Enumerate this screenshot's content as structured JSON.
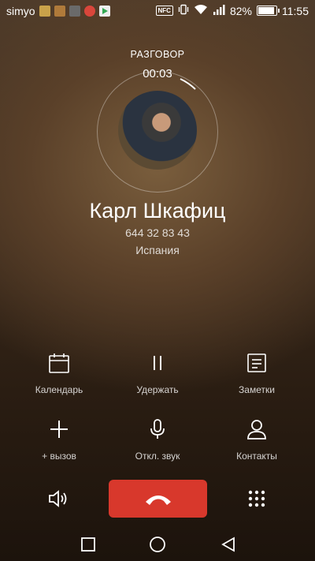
{
  "status_bar": {
    "carrier": "simyo",
    "battery_percent": "82%",
    "time": "11:55",
    "nfc": "NFC",
    "battery_level": 0.82,
    "notification_icons": [
      "music-app-icon",
      "gallery-icon",
      "photo-icon",
      "google-plus-icon",
      "play-store-icon"
    ],
    "notification_colors": [
      "#c9a24a",
      "#b07a3a",
      "#6a6a6a",
      "#d9463b",
      "#34a853"
    ]
  },
  "call": {
    "state": "РАЗГОВОР",
    "timer": "00:03",
    "contact_name": "Карл Шкафиц",
    "phone_number": "644 32 83 43",
    "location": "Испания"
  },
  "actions": {
    "calendar": "Календарь",
    "hold": "Удержать",
    "notes": "Заметки",
    "add_call": "+ вызов",
    "mute": "Откл. звук",
    "contacts": "Контакты"
  },
  "colors": {
    "end_call": "#d8382c"
  }
}
